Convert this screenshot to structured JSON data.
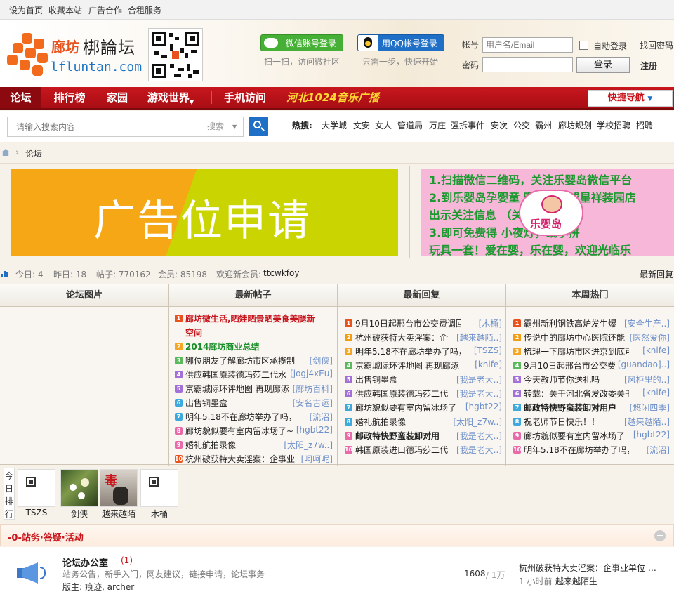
{
  "topbar": {
    "home": "设为首页",
    "fav": "收藏本站",
    "ad": "广告合作",
    "rent": "合租服务"
  },
  "logo": {
    "city": "廊坊",
    "name": "梆論坛",
    "url": "lfluntan.com"
  },
  "login": {
    "wechat_label": "微信账号登录",
    "wechat_tip": "扫一扫，访问微社区",
    "qq_label": "用QQ帐号登录",
    "qq_tip": "只需一步，快速开始",
    "account_label": "帐号",
    "account_placeholder": "用户名/Email",
    "auto_login": "自动登录",
    "find_pwd": "找回密码",
    "password_label": "密码",
    "login_button": "登录",
    "register": "注册"
  },
  "nav": {
    "items": [
      "论坛",
      "排行榜",
      "家园",
      "游戏世界",
      "手机访问"
    ],
    "radio": "河北1024音乐广播",
    "quicknav": "快捷导航"
  },
  "search": {
    "placeholder": "请输入搜索内容",
    "type": "搜索",
    "hot_label": "热搜:",
    "hot": [
      "大学城",
      "文安",
      "女人",
      "管道局",
      "万庄",
      "强拆事件",
      "安次",
      "公交",
      "霸州",
      "廊坊规划",
      "学校招聘",
      "招聘"
    ]
  },
  "breadcrumb": {
    "current": "论坛"
  },
  "ads": {
    "left_text": "广告位申请",
    "right_lines": [
      "1.扫描微信二维码，关注乐婴岛微信平台",
      "2.到乐婴岛孕婴童    曙光道店或星祥装园店",
      "出示关注信息               （关注即可）",
      "3.即可免费得               小夜灯，或小拼",
      "玩具一套！爱在婴，乐在婴，欢迎光临乐"
    ],
    "brand": "乐婴岛"
  },
  "stats": {
    "today": "今日: 4",
    "yesterday": "昨日: 18",
    "posts": "帖子: 770162",
    "members": "会员: 85198",
    "welcome": "欢迎新会员:",
    "newest": "ttcwkfoy",
    "latest_reply": "最新回复"
  },
  "columns": {
    "pics": "论坛图片",
    "new_posts": "最新帖子",
    "new_replies": "最新回复",
    "hot": "本周热门"
  },
  "new_posts": [
    {
      "t": "廊坊微生活,晒娃晒景晒美食美腿新",
      "a": "",
      "style": "red"
    },
    {
      "t": "空间",
      "a": "",
      "style": "red"
    },
    {
      "t": "2014廊坊商业总结",
      "a": "",
      "style": "green"
    },
    {
      "t": "哪位朋友了解廊坊市区承揽制",
      "a": "[剑侠]"
    },
    {
      "t": "供应韩国原装德玛莎二代水",
      "a": "[jogj4xEu]"
    },
    {
      "t": "京霸城际环评地图 再现廊涿",
      "a": "[廊坊百科]"
    },
    {
      "t": "出售铜墨盒",
      "a": "[安名吉运]"
    },
    {
      "t": "明年5.18不在廊坊举办了吗，",
      "a": "[流沼]"
    },
    {
      "t": "廊坊貌似要有室内留冰场了~",
      "a": "[hgbt22]"
    },
    {
      "t": "婚礼航拍录像",
      "a": "[太阳_z7w..]"
    },
    {
      "t": "杭州破获特大卖淫案：企事业",
      "a": "[呵呵呢]"
    }
  ],
  "new_replies": [
    {
      "t": "9月10日起邢台市公交费调回",
      "a": "[木桶]"
    },
    {
      "t": "杭州破获特大卖淫案：企",
      "a": "[越来越陌..]"
    },
    {
      "t": "明年5.18不在廊坊举办了吗，",
      "a": "[TSZS]"
    },
    {
      "t": "京霸城际环评地图 再现廊涿",
      "a": "[knife]"
    },
    {
      "t": "出售铜墨盒",
      "a": "[我是老大..]"
    },
    {
      "t": "供应韩国原装德玛莎二代",
      "a": "[我是老大..]"
    },
    {
      "t": "廊坊貌似要有室内留冰场了",
      "a": "[hgbt22]"
    },
    {
      "t": "婚礼航拍录像",
      "a": "[太阳_z7w..]"
    },
    {
      "t": "邮政特快野蛮装卸对用",
      "a": "[我是老大..]",
      "bold": true
    },
    {
      "t": "韩国原装进口德玛莎二代",
      "a": "[我是老大..]"
    }
  ],
  "hot": [
    {
      "t": "霸州新利钢铁高炉发生爆",
      "a": "[安全生产..]"
    },
    {
      "t": "传说中的廊坊中心医院还能",
      "a": "[医然爱你]"
    },
    {
      "t": "梳理一下廊坊市区进京到底可",
      "a": "[knife]"
    },
    {
      "t": "9月10日起邢台市公交费",
      "a": "[guandao]..]"
    },
    {
      "t": "今天教师节你送礼吗",
      "a": "[风柜里的..]"
    },
    {
      "t": "转载：关于河北省发改委关于",
      "a": "[knife]"
    },
    {
      "t": "邮政特快野蛮装卸对用户",
      "a": "[悠闲四季]",
      "bold": true
    },
    {
      "t": "祝老师节日快乐！！",
      "a": "[越来越陌..]"
    },
    {
      "t": "廊坊貌似要有室内留冰场了",
      "a": "[hgbt22]"
    },
    {
      "t": "明年5.18不在廊坊举办了吗，",
      "a": "[流沼]"
    }
  ],
  "rank": {
    "label_chars": [
      "今",
      "日",
      "排",
      "行"
    ],
    "users": [
      "TSZS",
      "剑侠",
      "越来越陌",
      "木桶"
    ]
  },
  "section": {
    "title": "-0-站务·答疑·活动"
  },
  "forum": {
    "name": "论坛办公室",
    "new_count": "(1)",
    "desc": "站务公告，新手入门，网友建议，链接申请，论坛事务",
    "mods_label": "版主:",
    "mods": "痕迹, archer",
    "threads": "1608",
    "posts": "/ 1万",
    "last_title": "杭州破获特大卖淫案：企事业单位 …",
    "last_time": "1 小时前",
    "last_user": "越来越陌生"
  },
  "colors": {
    "nav_red": "#c8161d",
    "accent_orange": "#e8531d",
    "link_blue": "#1b74c5",
    "author_blue": "#6d8fc9"
  }
}
